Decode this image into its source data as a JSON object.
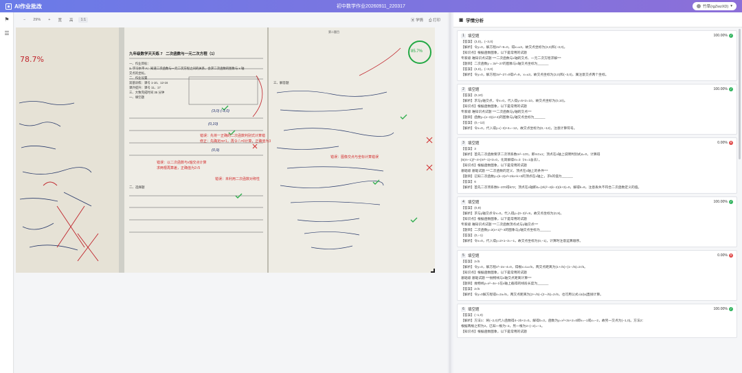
{
  "app": {
    "name": "AI作业批改",
    "doc_title": "初中数学作业20260911_220317",
    "user": "竹草(rgZwzXD)"
  },
  "viewer": {
    "zoom_minus": "−",
    "zoom_value": "29%",
    "zoom_plus": "+",
    "fit1": "宽",
    "fit2": "高",
    "fit3": "1:1",
    "analysis_btn": "学情",
    "print_btn": "打印"
  },
  "photo_text": {
    "score_left": "78.7%",
    "score_right": "85.7%",
    "page_title_1": "九年级数学天天练 7",
    "page_title_2": "二次函数与一元二次方程（1）",
    "section_1": "一、作业目标：",
    "goal_1": "1. 学习水平 A：知道二次函数与一元二次方程之间的关系，会求二次函数的图象与 x 轴",
    "goal_2": "交点的坐标。",
    "section_2": "二、作业设置",
    "setting_1": "双基训练：课号 1-10、12-16",
    "setting_2": "课外提升：课号 11、17",
    "setting_3": "三、大致完成时间 35 分钟",
    "section_fill": "一、填空题",
    "section_choice": "二、选择题",
    "section_solve": "三、解答题",
    "page_header_3": "第二题目",
    "red_note_1": "错误：先将一正确的二次函数判别式计算错",
    "red_note_2": "修正：先确定m≠1，再令△=0计算，正确值为3",
    "red_note_3": "错误：以二次函数与x轴交点计算",
    "red_note_4": "求两根再算差，正确值为2√5",
    "red_note_5": "错误：未利用二次函数对称性",
    "red_note_6": "错误：图像交点与坐标计算错误",
    "ans_1": "(3,0) (-3,0)",
    "ans_2": "(0,10)",
    "ans_3": "(0,9)"
  },
  "panel": {
    "title": "学情分析"
  },
  "cards": [
    {
      "num": "1",
      "type": "填空题",
      "score": "100.00%",
      "ok": true,
      "lines": [
        "【答案】(3,0)，(−3,0)",
        "【解析】令y=0，解方程2x²−9=0，得x=±3，故交点坐标为(3,0)和(−3,0)。",
        "【知识点】根据函数图象，以下是常用的试题",
        "专家级 难知识点试题 ***二次函数与x轴的交点、一元二次方程求解***",
        "【题目】二次函数y = 3x²−27的图象与x轴交点坐标为______",
        "【答案】(3,0)，(−3,0)",
        "【解析】令y=0，解方程3x²−27=0得x²=9，x=±3，故交点坐标为(3,0)和(−3,0)，属注意交点两个坐标。"
      ]
    },
    {
      "num": "2",
      "type": "填空题",
      "score": "100.00%",
      "ok": true,
      "lines": [
        "【答案】(0,10)",
        "【解析】求与y轴交点，令x=0，代入得y=5×2=10，故交点坐标为(0,10)。",
        "【知识点】根据函数图象，以下是常用的试题",
        "专家级 难知识点试题 ***二次函数与y轴的交点***",
        "【题目】函数y=(x−3)(x+4)的图象与y轴交点坐标为______",
        "【答案】(0,−12)",
        "【解析】令x=0，代入得y=(−3)×4=−12，故交点坐标为(0,−12)，注意计算符号。"
      ]
    },
    {
      "num": "3",
      "type": "填空题",
      "score": "0.00%",
      "ok": false,
      "lines": [
        "【答案】3",
        "【解析】首先二次函数要求二次项系数m²−1≠0，即m≠±1；顶点在x轴上说明判别式Δ=0，计算得",
        "[6(m−1)]²−4×(m²−1)×3=0，化简解得m=3（m=1舍去）。",
        "【知识点】根据函数图象，以下是常用的试题",
        "基础级 基础试题 ***二次函数的定义、顶点在x轴上的条件***",
        "【题目】已知二次函数y=(k−2)x²+2kx+k+3的顶点在x轴上，求k的值为______",
        "【答案】6",
        "【解析】首先二次项系数k−2≠0得k≠2；顶点在x轴即Δ=(2k)²−4(k−2)(k+3)=0，解得k=6，注意丢失不符合二次函数定义的值。"
      ]
    },
    {
      "num": "4",
      "type": "填空题",
      "score": "100.00%",
      "ok": true,
      "lines": [
        "【答案】(0,9)",
        "【解析】求与y轴交点令x=0，代入得y=(0−3)²=9，故交点坐标为(0,9)。",
        "【知识点】根据函数图象，以下是常用的试题",
        "专家级 难知识点试题 ***二次函数顶点式与y轴交点***",
        "【题目】二次函数y=2(x+1)²−3的图象与y轴交点坐标为______",
        "【答案】(0,−1)",
        "【解析】令x=0，代入得y=2×1−3=−1，故交点坐标为(0,−1)，计算时注意运算顺序。"
      ]
    },
    {
      "num": "5",
      "type": "填空题",
      "score": "0.00%",
      "ok": false,
      "lines": [
        "【答案】2√5",
        "【解析】令y=0，解方程x²−2x−4=0，得根x=1±√5，两交点距离为(1+√5)−(1−√5)=2√5。",
        "【知识点】根据函数图象，以下是常用的试题",
        "基础级 基础试题 ***抛物线与x轴交点距离计算***",
        "【题目】抛物线y=x²−4x−1在x轴上截得的线段长度为______",
        "【答案】2√5",
        "【解析】令y=0解方程得x=2±√5，两交点距离为(2+√5)−(2−√5)=2√5，也可用公式√Δ/|a|直接计算。"
      ]
    },
    {
      "num": "6",
      "type": "填空题",
      "score": "100.00%",
      "ok": true,
      "lines": [
        "【答案】(−1,0)",
        "【解析】方法1：将(−2,0)代入函数得4−2b+2=0，解得b=3，函数为y=x²+3x+2=0即x=−1或x=−2，故另一交点为(−1,0)。方法2：",
        "根据两根之积为2，已知一根为−2，另一根为2÷(−2)=−1。",
        "【知识点】根据函数图象，以下是常用的试题"
      ]
    }
  ]
}
